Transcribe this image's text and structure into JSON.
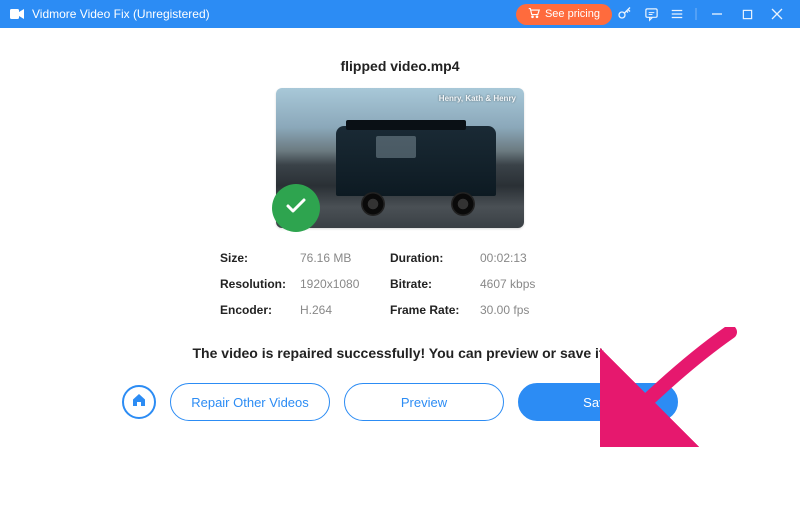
{
  "titlebar": {
    "app_name": "Vidmore Video Fix (Unregistered)",
    "pricing_label": "See pricing"
  },
  "file": {
    "name": "flipped video.mp4",
    "watermark": "Henry, Kath & Henry"
  },
  "info": {
    "size_label": "Size:",
    "size_value": "76.16 MB",
    "duration_label": "Duration:",
    "duration_value": "00:02:13",
    "resolution_label": "Resolution:",
    "resolution_value": "1920x1080",
    "bitrate_label": "Bitrate:",
    "bitrate_value": "4607 kbps",
    "encoder_label": "Encoder:",
    "encoder_value": "H.264",
    "framerate_label": "Frame Rate:",
    "framerate_value": "30.00 fps"
  },
  "status_message": "The video is repaired successfully! You can preview or save it.",
  "actions": {
    "repair_other": "Repair Other Videos",
    "preview": "Preview",
    "save": "Save"
  },
  "colors": {
    "accent": "#2c8cf4",
    "pricing": "#ff6b3d",
    "success": "#2ea44f",
    "arrow": "#e6186e"
  }
}
